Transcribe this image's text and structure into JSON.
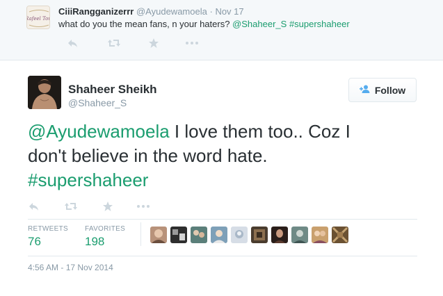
{
  "parent_tweet": {
    "display_name": "CiiiRangganizerrr",
    "handle": "@Ayudewamoela",
    "separator": "·",
    "time": "Nov 17",
    "text": "what do you  the mean fans, n your haters?",
    "mention": "@Shaheer_S",
    "hashtag": "#supershaheer",
    "avatar_text": "Rafeel Tom"
  },
  "main_tweet": {
    "display_name": "Shaheer Sheikh",
    "handle": "@Shaheer_S",
    "follow_label": "Follow",
    "text_mention": "@Ayudewamoela",
    "text_line1": " I love them too.. Coz I",
    "text_line2": "don't believe in the word hate.",
    "hashtag": "#supershaheer",
    "retweets_label": "RETWEETS",
    "retweets_count": "76",
    "favorites_label": "FAVORITES",
    "favorites_count": "198",
    "timestamp": "4:56 AM - 17 Nov 2014"
  },
  "icons": [
    "reply-icon",
    "retweet-icon",
    "favorite-icon",
    "more-icon",
    "follow-person-icon"
  ],
  "colors": {
    "accent_green": "#1b9d6f",
    "muted_gray": "#8899a6",
    "text_dark": "#292f33",
    "icon_gray": "#ccd6dd",
    "border": "#e1e8ed",
    "parent_bg": "#f5f8fa",
    "follow_icon_blue": "#55acee"
  }
}
